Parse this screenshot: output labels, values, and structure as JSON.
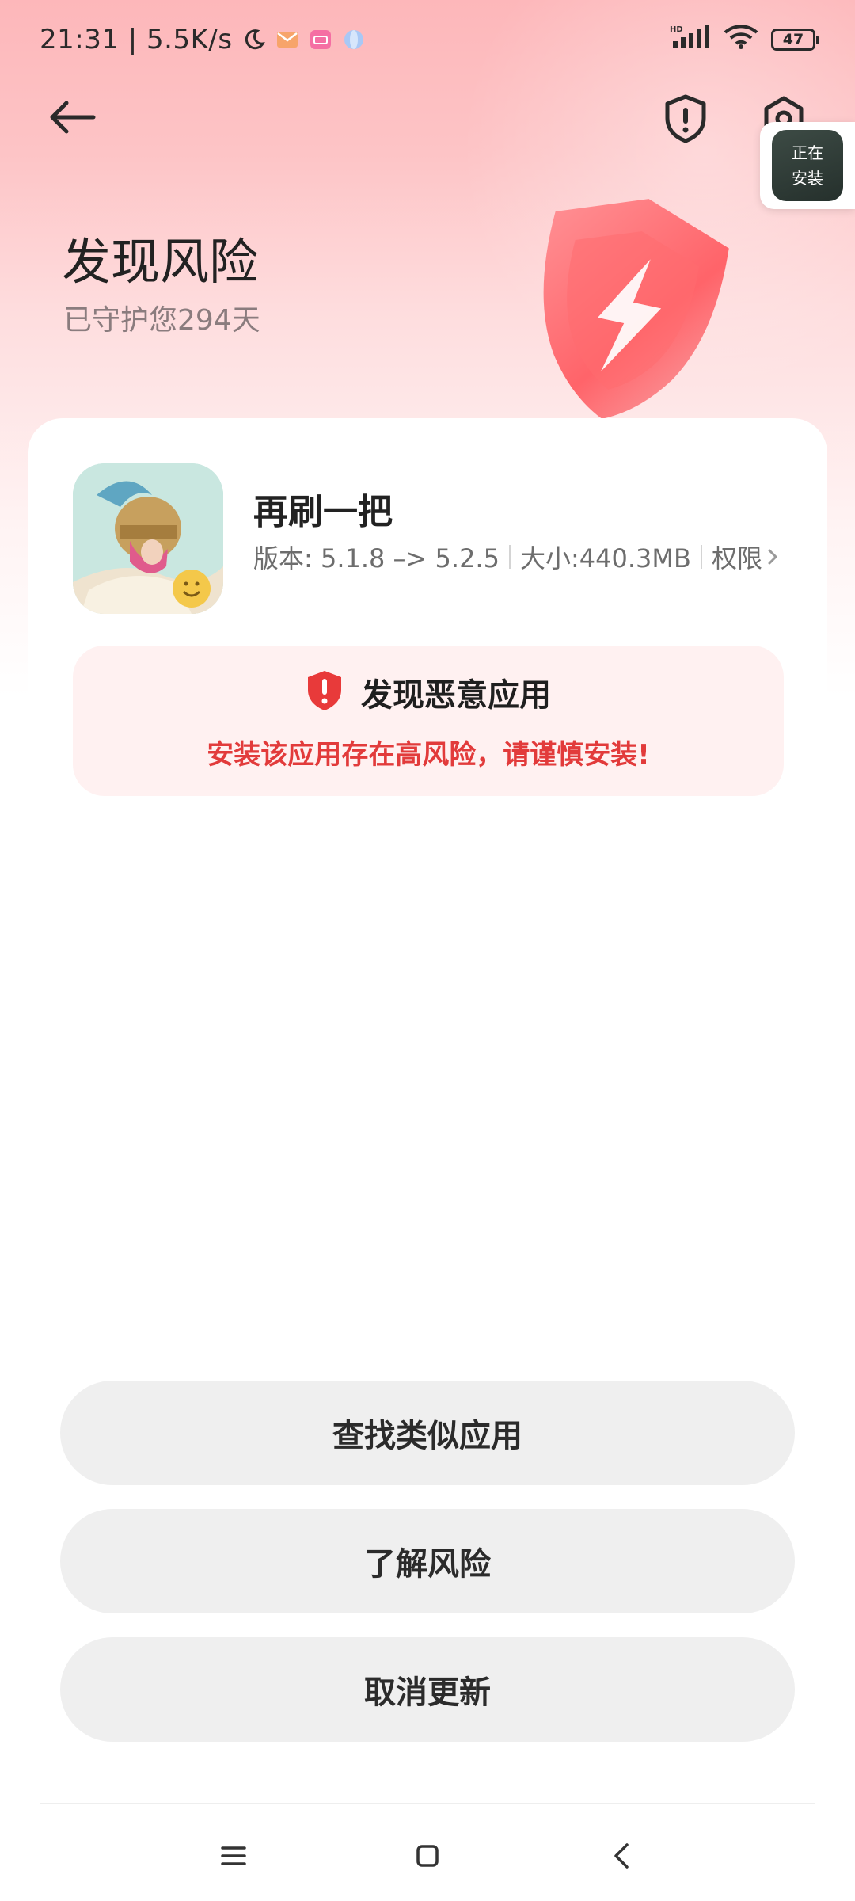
{
  "status_bar": {
    "time": "21:31 | 5.5K/s",
    "network_badge": "HD",
    "battery": "47"
  },
  "install_badge": {
    "line1": "正在",
    "line2": "安装"
  },
  "header": {
    "title": "发现风险",
    "subtitle": "已守护您294天"
  },
  "app": {
    "name": "再刷一把",
    "version": "版本: 5.1.8 –> 5.2.5",
    "size": "大小:440.3MB",
    "permissions": "权限"
  },
  "warning": {
    "title": "发现恶意应用",
    "description": "安装该应用存在高风险，请谨慎安装!"
  },
  "actions": {
    "find_similar": "查找类似应用",
    "learn_risk": "了解风险",
    "cancel_update": "取消更新"
  },
  "colors": {
    "accent_red": "#e23b3b",
    "hero_pink": "#fdb7ba",
    "button_gray": "#efefef"
  },
  "icons": {
    "status": [
      "moon-icon",
      "mail-icon",
      "app-icon",
      "orb-icon",
      "signal-icon",
      "wifi-icon",
      "battery-icon"
    ],
    "nav": [
      "back-arrow-icon",
      "shield-alert-icon",
      "settings-icon",
      "menu-icon",
      "home-icon",
      "back-chevron-icon"
    ]
  }
}
